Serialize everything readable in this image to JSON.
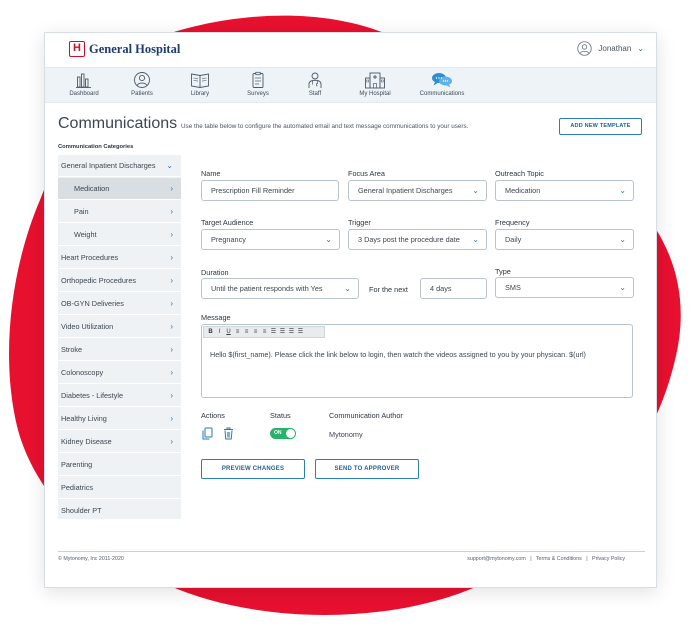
{
  "colors": {
    "accent": "#2b7fb8",
    "brand_red": "#c8102e",
    "toggle_on": "#27b36a"
  },
  "header": {
    "brand": "General Hospital",
    "logo_letter": "H",
    "user": "Jonathan"
  },
  "nav": [
    {
      "label": "Dashboard",
      "icon": "bar-chart-icon"
    },
    {
      "label": "Patients",
      "icon": "person-circle-icon"
    },
    {
      "label": "Library",
      "icon": "open-book-icon"
    },
    {
      "label": "Surveys",
      "icon": "clipboard-icon"
    },
    {
      "label": "Staff",
      "icon": "doctor-icon"
    },
    {
      "label": "My Hospital",
      "icon": "hospital-building-icon"
    },
    {
      "label": "Communications",
      "icon": "chat-bubbles-icon"
    }
  ],
  "page": {
    "title": "Communications",
    "description": "Use the table below to configure the automated email and text message communications to your users.",
    "add_button": "ADD NEW TEMPLATE",
    "categories_title": "Communication Categories"
  },
  "sidebar": [
    {
      "label": "General Inpatient Discharges",
      "arrow": "⌄"
    },
    {
      "label": "Medication",
      "arrow": "›"
    },
    {
      "label": "Pain",
      "arrow": "›"
    },
    {
      "label": "Weight",
      "arrow": "›"
    },
    {
      "label": "Heart Procedures",
      "arrow": "›"
    },
    {
      "label": "Orthopedic Procedures",
      "arrow": "›"
    },
    {
      "label": "OB-GYN Deliveries",
      "arrow": "›"
    },
    {
      "label": "Video Utilization",
      "arrow": "›"
    },
    {
      "label": "Stroke",
      "arrow": "›"
    },
    {
      "label": "Colonoscopy",
      "arrow": "›"
    },
    {
      "label": "Diabetes - Lifestyle",
      "arrow": "›"
    },
    {
      "label": "Healthy Living",
      "arrow": "›"
    },
    {
      "label": "Kidney Disease",
      "arrow": "›"
    },
    {
      "label": "Parenting",
      "arrow": ""
    },
    {
      "label": "Pediatrics",
      "arrow": ""
    },
    {
      "label": "Shoulder PT",
      "arrow": ""
    }
  ],
  "form": {
    "name_label": "Name",
    "name_value": "Prescription Fill Reminder",
    "focus_label": "Focus Area",
    "focus_value": "General Inpatient Discharges",
    "outreach_label": "Outreach Topic",
    "outreach_value": "Medication",
    "audience_label": "Target Audience",
    "audience_value": "Pregnancy",
    "trigger_label": "Trigger",
    "trigger_value": "3 Days post the procedure date",
    "frequency_label": "Frequency",
    "frequency_value": "Daily",
    "duration_label": "Duration",
    "duration_value": "Until the patient responds with Yes",
    "for_next_label": "For the next",
    "for_next_value": "4 days",
    "type_label": "Type",
    "type_value": "SMS",
    "message_label": "Message",
    "message_text": "Hello $(first_name). Please click the link below to login, then watch the videos assigned to you by your physican. $(url)",
    "toolbar": [
      "B",
      "I",
      "U",
      "≡",
      "≡",
      "≡",
      "≡",
      "☰",
      "☰",
      "☰",
      "☰"
    ],
    "actions_label": "Actions",
    "status_label": "Status",
    "status_value": "ON",
    "author_label": "Communication Author",
    "author_value": "Mytonomy",
    "preview_button": "PREVIEW CHANGES",
    "send_button": "SEND TO APPROVER"
  },
  "footer": {
    "copyright": "© Mytonomy, Inc 2011-2020",
    "links": "support@mytonomy.com   |   Terms & Conditions   |   Privacy Policy"
  }
}
